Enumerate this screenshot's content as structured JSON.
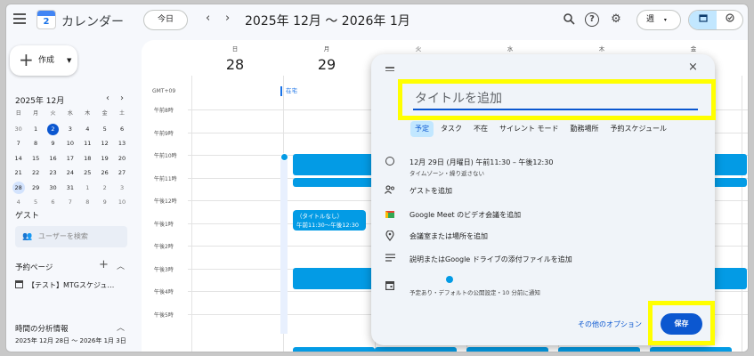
{
  "topbar": {
    "app_title": "カレンダー",
    "logo_number": "2",
    "today_label": "今日",
    "prev_arrow": "‹",
    "next_arrow": "›",
    "period": "2025年 12月 〜 2026年 1月",
    "view_label": "週",
    "view_caret": "▾"
  },
  "sidebar": {
    "create_label": "作成",
    "mini_month": "2025年 12月",
    "mini_prev": "‹",
    "mini_next": "›",
    "weekdays": [
      "日",
      "月",
      "火",
      "水",
      "木",
      "金",
      "土"
    ],
    "weeks": [
      [
        "30",
        "1",
        "2",
        "3",
        "4",
        "5",
        "6"
      ],
      [
        "7",
        "8",
        "9",
        "10",
        "11",
        "12",
        "13"
      ],
      [
        "14",
        "15",
        "16",
        "17",
        "18",
        "19",
        "20"
      ],
      [
        "21",
        "22",
        "23",
        "24",
        "25",
        "26",
        "27"
      ],
      [
        "28",
        "29",
        "30",
        "31",
        "1",
        "2",
        "3"
      ],
      [
        "4",
        "5",
        "6",
        "7",
        "8",
        "9",
        "10"
      ]
    ],
    "today_date": "2",
    "selected_date": "28",
    "guest_heading": "ゲスト",
    "user_search_placeholder": "ユーザーを検索",
    "booking_heading": "予約ページ",
    "booking_plus": "+",
    "booking_item": "【テスト】MTGスケジュ…",
    "analysis_heading": "時間の分析情報",
    "analysis_range": "2025年 12月 28日 〜 2026年 1月 3日"
  },
  "calendar": {
    "days": [
      {
        "dow": "日",
        "num": "28"
      },
      {
        "dow": "月",
        "num": "29"
      },
      {
        "dow": "火",
        "num": ""
      },
      {
        "dow": "水",
        "num": ""
      },
      {
        "dow": "木",
        "num": ""
      },
      {
        "dow": "金",
        "num": ""
      }
    ],
    "gmt_label": "GMT+09",
    "allday_event": "在宅",
    "time_labels": [
      "午前8時",
      "午前9時",
      "午前10時",
      "午前11時",
      "午後12時",
      "午後1時",
      "午後2時",
      "午後3時",
      "午後4時",
      "午後5時"
    ],
    "draft_chip_title": "（タイトルなし）",
    "draft_chip_time": "午前11:30〜午後12:30"
  },
  "dialog": {
    "close": "×",
    "title_placeholder": "タイトルを追加",
    "tabs": [
      "予定",
      "タスク",
      "不在",
      "サイレント モード",
      "勤務場所",
      "予約スケジュール"
    ],
    "datetime": "12月 29日 (月曜日)    午前11:30  –  午後12:30",
    "timezone_note": "タイムゾーン・繰り返さない",
    "add_guests": "ゲストを追加",
    "add_meet": "Google Meet のビデオ会議を追加",
    "add_location": "会議室または場所を追加",
    "add_description": "説明またはGoogle ドライブの添付ファイルを追加",
    "status_line": "予定あり・デフォルトの公開設定・10 分前に通知",
    "more_options": "その他のオプション",
    "save": "保存"
  },
  "colors": {
    "accent": "#0b57d0",
    "event": "#039be5",
    "highlight": "#ffff00",
    "tab_active": "#c2e7ff"
  }
}
